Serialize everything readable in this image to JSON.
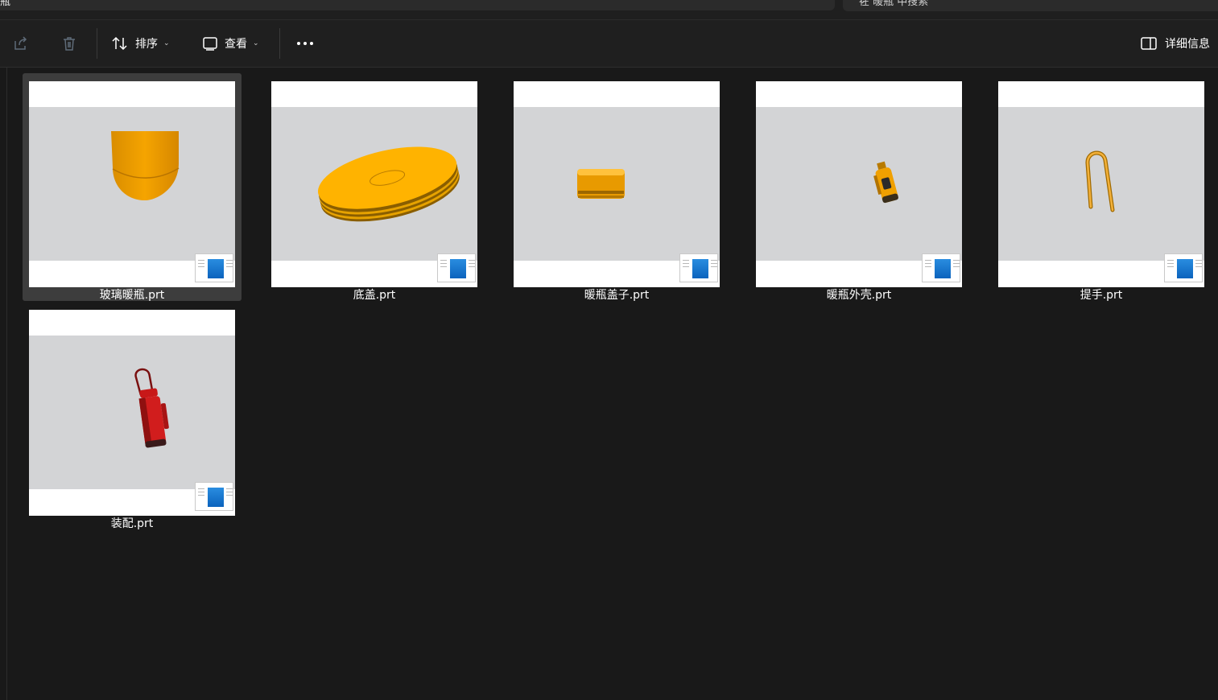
{
  "address_bar": {
    "text": "瓶"
  },
  "search": {
    "placeholder": "在 暖瓶 中搜索"
  },
  "toolbar": {
    "share_icon": "share-icon",
    "delete_icon": "trash-icon",
    "sort_label": "排序",
    "view_label": "查看",
    "more_icon": "more-icon",
    "details_label": "详细信息"
  },
  "files": [
    {
      "name": "玻璃暖瓶.prt",
      "selected": true
    },
    {
      "name": "底盖.prt",
      "selected": false
    },
    {
      "name": "暖瓶盖子.prt",
      "selected": false
    },
    {
      "name": "暖瓶外壳.prt",
      "selected": false
    },
    {
      "name": "提手.prt",
      "selected": false
    },
    {
      "name": "装配.prt",
      "selected": false
    }
  ],
  "colors": {
    "background": "#191919",
    "toolbar": "#1f1f1f",
    "selection": "#3d3d3d",
    "part_orange": "#f5a400",
    "part_red": "#d11d1d",
    "viewport_gray": "#d3d4d6"
  }
}
